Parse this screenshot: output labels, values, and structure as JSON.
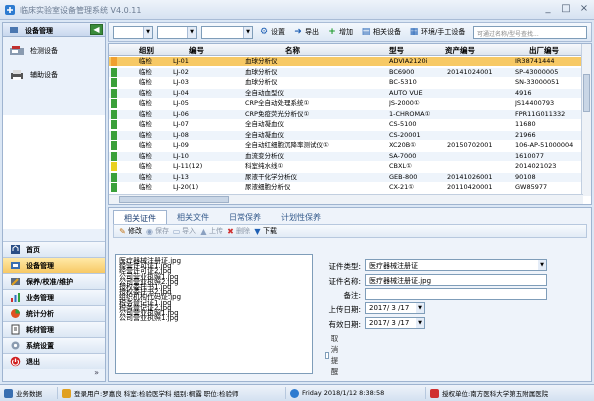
{
  "app": {
    "title": "临床实验室设备管理系统 V4.0.11"
  },
  "window_controls": [
    "_",
    "□",
    "×"
  ],
  "left_panel": {
    "header": "设备管理",
    "collapse": "◀",
    "devices": [
      {
        "label": "检测设备",
        "icon": "instrument-icon"
      },
      {
        "label": "辅助设备",
        "icon": "printer-icon"
      }
    ],
    "nav": [
      {
        "label": "首页",
        "icon": "home-icon",
        "active": false
      },
      {
        "label": "设备管理",
        "icon": "device-manage-icon",
        "active": true
      },
      {
        "label": "保养/校准/维护",
        "icon": "maintenance-icon",
        "active": false
      },
      {
        "label": "业务管理",
        "icon": "business-icon",
        "active": false
      },
      {
        "label": "统计分析",
        "icon": "statistics-icon",
        "active": false
      },
      {
        "label": "耗材管理",
        "icon": "consumables-icon",
        "active": false
      },
      {
        "label": "系统设置",
        "icon": "settings-icon",
        "active": false
      },
      {
        "label": "退出",
        "icon": "exit-icon",
        "active": false
      }
    ],
    "expand": "»"
  },
  "toolbar": {
    "buttons": [
      {
        "label": "设置",
        "icon": "gear-icon",
        "glyph": "⚙",
        "color": "#1e5fb4"
      },
      {
        "label": "导出",
        "icon": "export-icon",
        "glyph": "➜",
        "color": "#1e5fb4"
      },
      {
        "label": "增加",
        "icon": "add-icon",
        "glyph": "+",
        "color": "#1c9a2a"
      },
      {
        "label": "相关设备",
        "icon": "related-devices-icon",
        "glyph": "▤",
        "color": "#1e5fb4"
      },
      {
        "label": "环境/手工设备",
        "icon": "environment-icon",
        "glyph": "▦",
        "color": "#1e5fb4"
      }
    ],
    "search_placeholder": "可通过名称/型号查找..."
  },
  "grid": {
    "columns": [
      "组别",
      "编号",
      "名称",
      "型号",
      "资产编号",
      "出厂编号"
    ],
    "rows": [
      {
        "group": "临检",
        "num": "LJ-01",
        "name": "血球分析仪",
        "model": "ADVIA2120i",
        "asset": "",
        "factory": "IR38741444",
        "selected": true,
        "marker": "#f0a030"
      },
      {
        "group": "临检",
        "num": "LJ-02",
        "name": "血球分析仪",
        "model": "BC6900",
        "asset": "20141024001",
        "factory": "SP-43000005",
        "selected": false,
        "marker": "#3aa03a"
      },
      {
        "group": "临检",
        "num": "LJ-03",
        "name": "血球分析仪",
        "model": "BC-5310",
        "asset": "",
        "factory": "SN-33000051",
        "selected": false,
        "marker": "#3aa03a"
      },
      {
        "group": "临检",
        "num": "LJ-04",
        "name": "全自动血型仪",
        "model": "AUTO VUE",
        "asset": "",
        "factory": "4916",
        "selected": false,
        "marker": "#3aa03a"
      },
      {
        "group": "临检",
        "num": "LJ-05",
        "name": "CRP全自动处理系统①",
        "model": "JS-2000①",
        "asset": "",
        "factory": "JS14400793",
        "selected": false,
        "marker": "#3aa03a"
      },
      {
        "group": "临检",
        "num": "LJ-06",
        "name": "CRP免疫荧光分析仪①",
        "model": "1-CHROMA①",
        "asset": "",
        "factory": "FPR11G011332",
        "selected": false,
        "marker": "#3aa03a"
      },
      {
        "group": "临检",
        "num": "LJ-07",
        "name": "全自动凝血仪",
        "model": "CS-5100",
        "asset": "",
        "factory": "11680",
        "selected": false,
        "marker": "#3aa03a"
      },
      {
        "group": "临检",
        "num": "LJ-08",
        "name": "全自动凝血仪",
        "model": "CS-20001",
        "asset": "",
        "factory": "21966",
        "selected": false,
        "marker": "#3aa03a"
      },
      {
        "group": "临检",
        "num": "LJ-09",
        "name": "全自动红细胞沉降率测试仪①",
        "model": "XC20B①",
        "asset": "20150702001",
        "factory": "106-AP-51000004",
        "selected": false,
        "marker": "#3aa03a"
      },
      {
        "group": "临检",
        "num": "LJ-10",
        "name": "血流变分析仪",
        "model": "SA-7000",
        "asset": "",
        "factory": "1610077",
        "selected": false,
        "marker": "#3aa03a"
      },
      {
        "group": "临检",
        "num": "LJ-11(12)",
        "name": "科室纯水线①",
        "model": "CBXL①",
        "asset": "",
        "factory": "2014021023",
        "selected": false,
        "marker": "#e8d020"
      },
      {
        "group": "临检",
        "num": "LJ-13",
        "name": "尿液干化学分析仪",
        "model": "GEB-800",
        "asset": "20141026001",
        "factory": "90108",
        "selected": false,
        "marker": "#3aa03a"
      },
      {
        "group": "临检",
        "num": "LJ-20(1)",
        "name": "尿液细胞分析仪",
        "model": "CX-21①",
        "asset": "20110420001",
        "factory": "GW85977",
        "selected": false,
        "marker": "#3aa03a"
      }
    ]
  },
  "detail": {
    "tabs": [
      "相关证件",
      "相关文件",
      "日常保养",
      "计划性保养"
    ],
    "subtoolbar": [
      {
        "label": "修改",
        "icon": "edit-icon",
        "glyph": "✎",
        "enabled": true
      },
      {
        "label": "保存",
        "icon": "save-icon",
        "glyph": "◉",
        "enabled": false
      },
      {
        "label": "导入",
        "icon": "import-icon",
        "glyph": "▭",
        "enabled": false
      },
      {
        "label": "上传",
        "icon": "upload-icon",
        "glyph": "▲",
        "enabled": false
      },
      {
        "label": "删除",
        "icon": "delete-icon",
        "glyph": "✖",
        "enabled": false
      },
      {
        "label": "下载",
        "icon": "download-icon",
        "glyph": "▼",
        "enabled": true
      }
    ],
    "cert_files": [
      "医疗器械注册证.jpg",
      "经营许可证1.jpg",
      "经营许可证2.jpg",
      "公司营业执照1.jpg",
      "公司营业执照2.jpg",
      "授权委托书1.jpg",
      "授权委托书2.jpg",
      "组织机构代码证.jpg",
      "税务登记证1.jpg",
      "税务登记证2.jpg",
      "公司营业执照1.jpg",
      "公司营业执照1.jpg"
    ],
    "form": {
      "cert_type_label": "证件类型:",
      "cert_type": "医疗器械注册证",
      "cert_name_label": "证件名称:",
      "cert_name": "医疗器械注册证.jpg",
      "remark_label": "备注:",
      "remark": "",
      "upload_date_label": "上传日期:",
      "upload_date": "2017/ 3 /17",
      "valid_date_label": "有效日期:",
      "valid_date": "2017/ 3 /17",
      "cancel_remind_label": "取消提醒"
    }
  },
  "statusbar": {
    "items": [
      "业务数据",
      "登录用户:罗嘉良  科室:检验医学科  组别:桐露  职位:检验师",
      "Friday 2018/1/12 8:38:58",
      "授权单位:南方医科大学第五附属医院"
    ]
  }
}
